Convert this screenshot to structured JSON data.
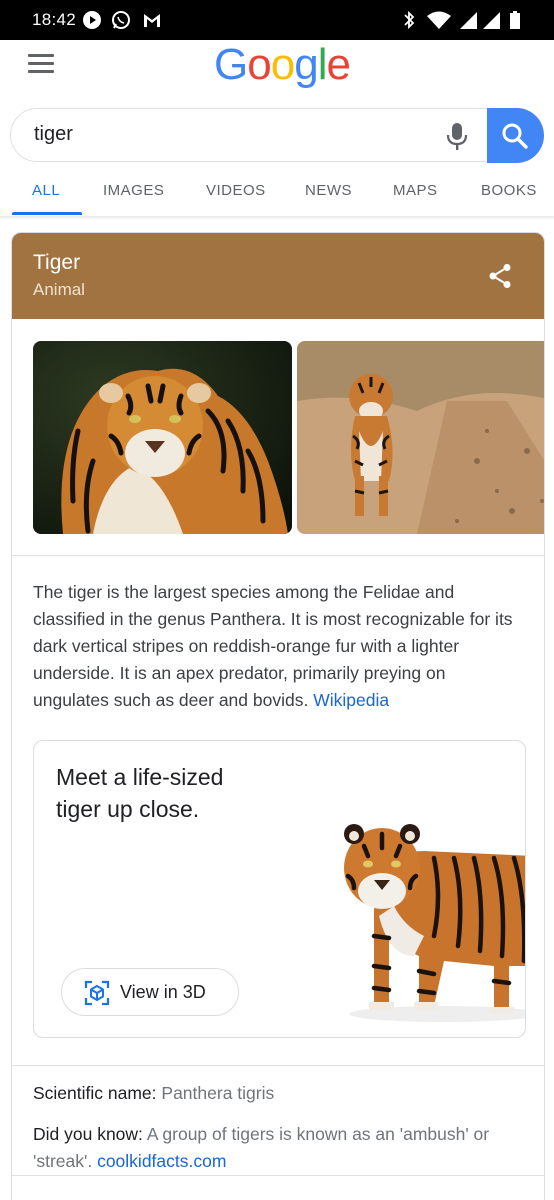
{
  "status_bar": {
    "time": "18:42",
    "left_icons": [
      "play-icon",
      "whatsapp-icon",
      "gmail-icon"
    ],
    "right_icons": [
      "bluetooth-icon",
      "wifi-icon",
      "signal-icon",
      "signal-icon",
      "battery-icon"
    ]
  },
  "header": {
    "logo_letters": [
      {
        "ch": "G",
        "color": "#4285f4"
      },
      {
        "ch": "o",
        "color": "#ea4335"
      },
      {
        "ch": "o",
        "color": "#fbbc05"
      },
      {
        "ch": "g",
        "color": "#4285f4"
      },
      {
        "ch": "l",
        "color": "#34a853"
      },
      {
        "ch": "e",
        "color": "#ea4335"
      }
    ]
  },
  "search": {
    "query": "tiger"
  },
  "tabs": [
    {
      "label": "ALL",
      "active": true
    },
    {
      "label": "IMAGES",
      "active": false
    },
    {
      "label": "VIDEOS",
      "active": false
    },
    {
      "label": "NEWS",
      "active": false
    },
    {
      "label": "MAPS",
      "active": false
    },
    {
      "label": "BOOKS",
      "active": false
    }
  ],
  "knowledge_panel": {
    "title": "Tiger",
    "subtitle": "Animal",
    "header_color": "#a07341",
    "description": "The tiger is the largest species among the Felidae and classified in the genus Panthera. It is most recognizable for its dark vertical stripes on reddish-orange fur with a lighter underside. It is an apex predator, primarily preying on ungulates such as deer and bovids.",
    "source_link": "Wikipedia",
    "ar_card": {
      "title": "Meet a life-sized tiger up close.",
      "button_label": "View in 3D"
    },
    "facts": [
      {
        "label": "Scientific name:",
        "value": "Panthera tigris",
        "link": ""
      },
      {
        "label": "Did you know:",
        "value": "A group of tigers is known as an 'ambush' or 'streak'.",
        "link": "coolkidfacts.com"
      }
    ]
  }
}
